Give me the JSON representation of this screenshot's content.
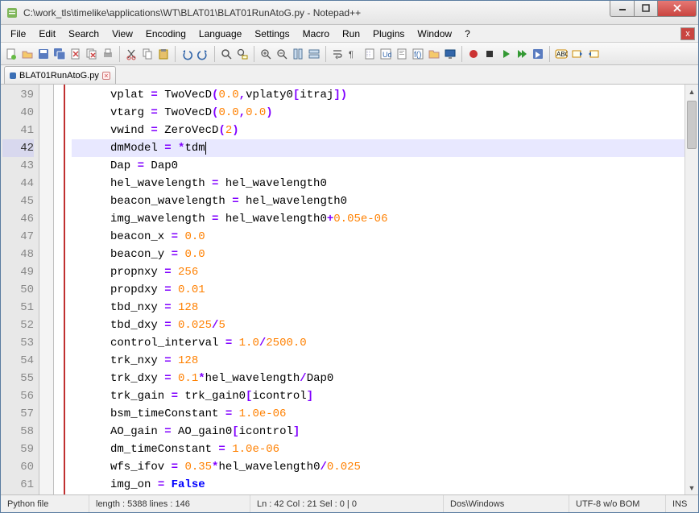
{
  "window": {
    "title": "C:\\work_tls\\timelike\\applications\\WT\\BLAT01\\BLAT01RunAtoG.py - Notepad++"
  },
  "menu": [
    "File",
    "Edit",
    "Search",
    "View",
    "Encoding",
    "Language",
    "Settings",
    "Macro",
    "Run",
    "Plugins",
    "Window",
    "?"
  ],
  "tabs": [
    {
      "label": "BLAT01RunAtoG.py"
    }
  ],
  "status": {
    "filetype": "Python file",
    "length": "length : 5388    lines : 146",
    "pos": "Ln : 42    Col : 21    Sel : 0 | 0",
    "eol": "Dos\\Windows",
    "encoding": "UTF-8 w/o BOM",
    "mode": "INS"
  },
  "editor": {
    "first_line": 39,
    "current_line": 42,
    "lines": [
      {
        "n": 39,
        "t": [
          [
            "",
            "vplat "
          ],
          [
            "op",
            "="
          ],
          [
            "",
            " TwoVecD"
          ],
          [
            "op",
            "("
          ],
          [
            "num",
            "0.0"
          ],
          [
            "op",
            ","
          ],
          [
            "",
            "vplaty0"
          ],
          [
            "op",
            "["
          ],
          [
            "",
            "itraj"
          ],
          [
            "op",
            "]"
          ],
          [
            "op",
            ")"
          ]
        ]
      },
      {
        "n": 40,
        "t": [
          [
            "",
            "vtarg "
          ],
          [
            "op",
            "="
          ],
          [
            "",
            " TwoVecD"
          ],
          [
            "op",
            "("
          ],
          [
            "num",
            "0.0"
          ],
          [
            "op",
            ","
          ],
          [
            "num",
            "0.0"
          ],
          [
            "op",
            ")"
          ]
        ]
      },
      {
        "n": 41,
        "t": [
          [
            "",
            "vwind "
          ],
          [
            "op",
            "="
          ],
          [
            "",
            " ZeroVecD"
          ],
          [
            "op",
            "("
          ],
          [
            "num",
            "2"
          ],
          [
            "op",
            ")"
          ]
        ]
      },
      {
        "n": 42,
        "cur": true,
        "t": [
          [
            "",
            "dmModel "
          ],
          [
            "op",
            "="
          ],
          [
            "",
            " "
          ],
          [
            "op",
            "*"
          ],
          [
            "",
            "tdm"
          ]
        ]
      },
      {
        "n": 43,
        "t": [
          [
            "",
            "Dap "
          ],
          [
            "op",
            "="
          ],
          [
            "",
            " Dap0"
          ]
        ]
      },
      {
        "n": 44,
        "t": [
          [
            "",
            "hel_wavelength "
          ],
          [
            "op",
            "="
          ],
          [
            "",
            " hel_wavelength0"
          ]
        ]
      },
      {
        "n": 45,
        "t": [
          [
            "",
            "beacon_wavelength "
          ],
          [
            "op",
            "="
          ],
          [
            "",
            " hel_wavelength0"
          ]
        ]
      },
      {
        "n": 46,
        "t": [
          [
            "",
            "img_wavelength "
          ],
          [
            "op",
            "="
          ],
          [
            "",
            " hel_wavelength0"
          ],
          [
            "op",
            "+"
          ],
          [
            "num",
            "0.05e-06"
          ]
        ]
      },
      {
        "n": 47,
        "t": [
          [
            "",
            "beacon_x "
          ],
          [
            "op",
            "="
          ],
          [
            "",
            " "
          ],
          [
            "num",
            "0.0"
          ]
        ]
      },
      {
        "n": 48,
        "t": [
          [
            "",
            "beacon_y "
          ],
          [
            "op",
            "="
          ],
          [
            "",
            " "
          ],
          [
            "num",
            "0.0"
          ]
        ]
      },
      {
        "n": 49,
        "t": [
          [
            "",
            "propnxy "
          ],
          [
            "op",
            "="
          ],
          [
            "",
            " "
          ],
          [
            "num",
            "256"
          ]
        ]
      },
      {
        "n": 50,
        "t": [
          [
            "",
            "propdxy "
          ],
          [
            "op",
            "="
          ],
          [
            "",
            " "
          ],
          [
            "num",
            "0.01"
          ]
        ]
      },
      {
        "n": 51,
        "t": [
          [
            "",
            "tbd_nxy "
          ],
          [
            "op",
            "="
          ],
          [
            "",
            " "
          ],
          [
            "num",
            "128"
          ]
        ]
      },
      {
        "n": 52,
        "t": [
          [
            "",
            "tbd_dxy "
          ],
          [
            "op",
            "="
          ],
          [
            "",
            " "
          ],
          [
            "num",
            "0.025"
          ],
          [
            "op",
            "/"
          ],
          [
            "num",
            "5"
          ]
        ]
      },
      {
        "n": 53,
        "t": [
          [
            "",
            "control_interval "
          ],
          [
            "op",
            "="
          ],
          [
            "",
            " "
          ],
          [
            "num",
            "1.0"
          ],
          [
            "op",
            "/"
          ],
          [
            "num",
            "2500.0"
          ]
        ]
      },
      {
        "n": 54,
        "t": [
          [
            "",
            "trk_nxy "
          ],
          [
            "op",
            "="
          ],
          [
            "",
            " "
          ],
          [
            "num",
            "128"
          ]
        ]
      },
      {
        "n": 55,
        "t": [
          [
            "",
            "trk_dxy "
          ],
          [
            "op",
            "="
          ],
          [
            "",
            " "
          ],
          [
            "num",
            "0.1"
          ],
          [
            "op",
            "*"
          ],
          [
            "",
            "hel_wavelength"
          ],
          [
            "op",
            "/"
          ],
          [
            "",
            "Dap0"
          ]
        ]
      },
      {
        "n": 56,
        "t": [
          [
            "",
            "trk_gain "
          ],
          [
            "op",
            "="
          ],
          [
            "",
            " trk_gain0"
          ],
          [
            "op",
            "["
          ],
          [
            "",
            "icontrol"
          ],
          [
            "op",
            "]"
          ]
        ]
      },
      {
        "n": 57,
        "t": [
          [
            "",
            "bsm_timeConstant "
          ],
          [
            "op",
            "="
          ],
          [
            "",
            " "
          ],
          [
            "num",
            "1.0e-06"
          ]
        ]
      },
      {
        "n": 58,
        "t": [
          [
            "",
            "AO_gain "
          ],
          [
            "op",
            "="
          ],
          [
            "",
            " AO_gain0"
          ],
          [
            "op",
            "["
          ],
          [
            "",
            "icontrol"
          ],
          [
            "op",
            "]"
          ]
        ]
      },
      {
        "n": 59,
        "t": [
          [
            "",
            "dm_timeConstant "
          ],
          [
            "op",
            "="
          ],
          [
            "",
            " "
          ],
          [
            "num",
            "1.0e-06"
          ]
        ]
      },
      {
        "n": 60,
        "t": [
          [
            "",
            "wfs_ifov "
          ],
          [
            "op",
            "="
          ],
          [
            "",
            " "
          ],
          [
            "num",
            "0.35"
          ],
          [
            "op",
            "*"
          ],
          [
            "",
            "hel_wavelength0"
          ],
          [
            "op",
            "/"
          ],
          [
            "num",
            "0.025"
          ]
        ]
      },
      {
        "n": 61,
        "t": [
          [
            "",
            "img_on "
          ],
          [
            "op",
            "="
          ],
          [
            "",
            " "
          ],
          [
            "kw",
            "False"
          ]
        ]
      }
    ]
  }
}
